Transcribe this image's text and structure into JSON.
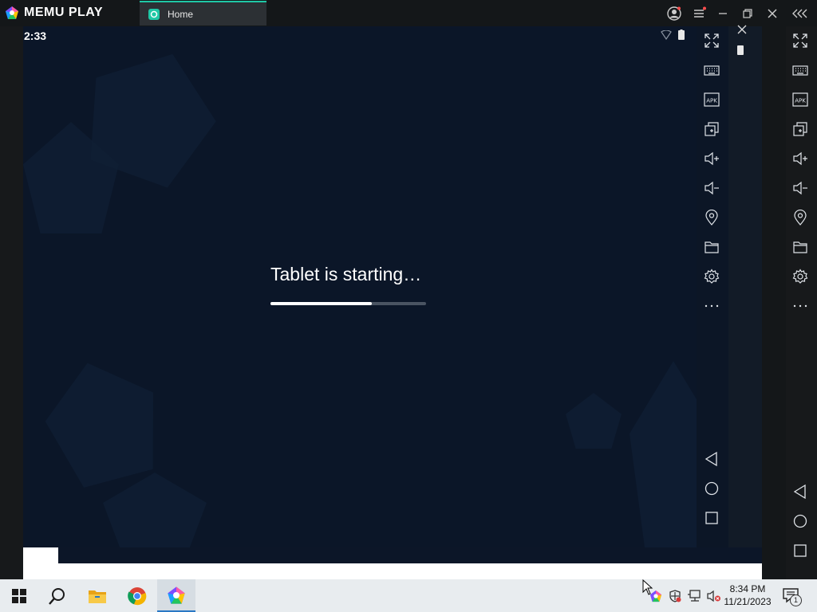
{
  "app": {
    "name": "MEMU PLAY",
    "tab_label": "Home"
  },
  "android": {
    "clock": "2:33",
    "loading_text": "Tablet is starting…",
    "progress": 0.65
  },
  "inner_toolbar": {
    "items": [
      "fullscreen-icon",
      "keyboard-icon",
      "apk-icon",
      "multi-instance-icon",
      "volume-up-icon",
      "volume-down-icon",
      "location-icon",
      "folder-icon",
      "settings-icon",
      "more-icon"
    ],
    "nav": [
      "back-icon",
      "home-icon",
      "recents-icon"
    ]
  },
  "outer_sidebar": {
    "items": [
      "fullscreen-icon",
      "keyboard-icon",
      "apk-icon",
      "multi-instance-icon",
      "volume-up-icon",
      "volume-down-icon",
      "location-icon",
      "folder-icon",
      "settings-icon",
      "more-icon"
    ],
    "nav": [
      "back-icon",
      "home-icon",
      "recents-icon"
    ]
  },
  "apk_label": "APK",
  "taskbar": {
    "time": "8:34 PM",
    "date": "11/21/2023",
    "notification_count": "1"
  },
  "colors": {
    "accent": "#1fc8a6",
    "screen_bg": "#0b1628",
    "badge": "#ff4d4d"
  }
}
